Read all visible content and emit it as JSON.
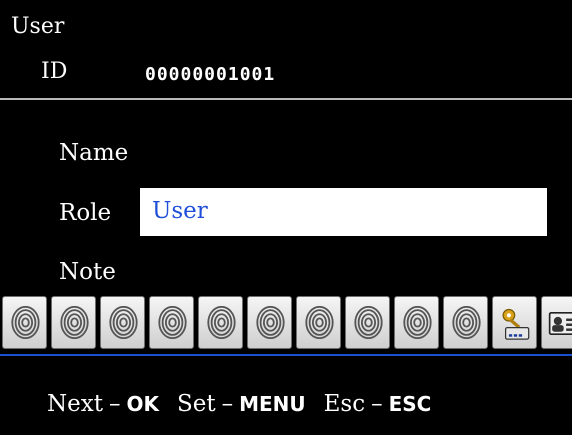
{
  "header": {
    "title": "User",
    "id_label": "ID",
    "id_value": "00000001001"
  },
  "form": {
    "name_label": "Name",
    "role_label": "Role",
    "role_value": "User",
    "note_label": "Note"
  },
  "icon_strip": {
    "fingerprint_count": 10,
    "icons": [
      "fingerprint-icon",
      "key-card-icon",
      "id-card-icon"
    ]
  },
  "footer": {
    "next_label": "Next",
    "next_key": "OK",
    "set_label": "Set",
    "set_key": "MENU",
    "esc_label": "Esc",
    "esc_key": "ESC",
    "separator": "–"
  },
  "colors": {
    "background": "#000000",
    "text": "#ffffff",
    "role_value_text": "#1f4fd8",
    "divider_blue": "#1a4fd0"
  }
}
